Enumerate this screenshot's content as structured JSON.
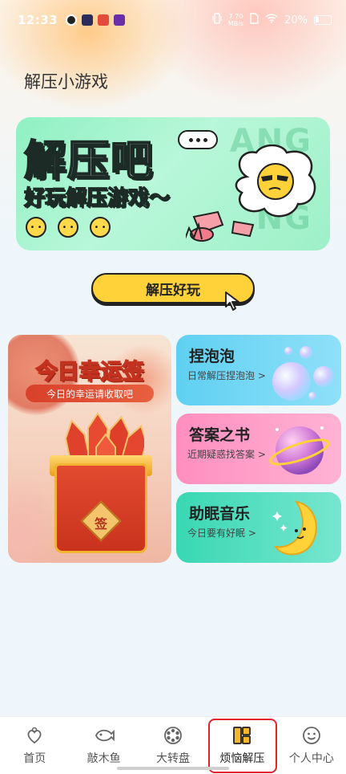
{
  "status_bar": {
    "time": "12:33",
    "network_speed_value": "7.70",
    "network_speed_unit": "MB/s",
    "battery": "20%"
  },
  "page": {
    "title": "解压小游戏"
  },
  "banner": {
    "title": "解压吧",
    "subtitle": "好玩解压游戏～",
    "bg_letters": [
      "ANG",
      "NG",
      "NG"
    ]
  },
  "cta": {
    "label": "解压好玩"
  },
  "cards": {
    "fortune": {
      "title": "今日幸运签",
      "subtitle": "今日的幸运请收取吧",
      "seal": "签"
    },
    "bubble": {
      "title": "捏泡泡",
      "desc": "日常解压捏泡泡 >"
    },
    "answer": {
      "title": "答案之书",
      "desc": "近期疑惑找答案 >"
    },
    "sleep": {
      "title": "助眠音乐",
      "desc": "今日要有好眠 >"
    }
  },
  "bottom_nav": {
    "items": [
      {
        "label": "首页",
        "icon": "home-icon"
      },
      {
        "label": "敲木鱼",
        "icon": "wooden-fish-icon"
      },
      {
        "label": "大转盘",
        "icon": "wheel-icon"
      },
      {
        "label": "烦恼解压",
        "icon": "grid-icon",
        "active": true
      },
      {
        "label": "个人中心",
        "icon": "profile-icon"
      }
    ]
  },
  "colors": {
    "accent_yellow": "#ffd23a",
    "banner_green": "#8ff0c3",
    "highlight_red": "#e2222c"
  }
}
